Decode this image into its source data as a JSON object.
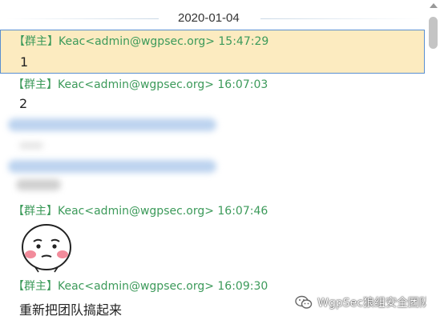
{
  "chat": {
    "date_separator": "2020-01-04",
    "messages": [
      {
        "header": "【群主】Keac<admin@wgpsec.org> 15:47:29",
        "body": "1"
      },
      {
        "header": "【群主】Keac<admin@wgpsec.org> 16:07:03",
        "body": "2"
      },
      {
        "header": "【群主】Keac<admin@wgpsec.org> 16:07:46",
        "body": ""
      },
      {
        "header": "【群主】Keac<admin@wgpsec.org> 16:09:30",
        "body": "重新把团队搞起来"
      }
    ]
  },
  "icons": {
    "sticker": "blushing-face-sticker-icon",
    "watermark": "wechat-icon"
  },
  "watermark": {
    "text": "WgpSec狼组安全团队"
  },
  "colors": {
    "highlight_bg": "#fcebc0",
    "highlight_border": "#5a8fd0",
    "header_green": "#3c9a5a"
  }
}
